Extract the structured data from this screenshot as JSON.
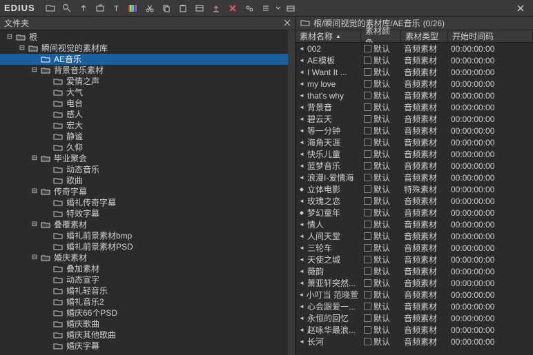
{
  "brand": "EDIUS",
  "left_panel_title": "文件夹",
  "right_panel": {
    "path": "根/瞬间视觉的素材库/AE音乐",
    "count": "(0/26)"
  },
  "columns": {
    "name": "素材名称",
    "color": "素材颜色",
    "type": "素材类型",
    "time": "开始时间码"
  },
  "tree": [
    {
      "label": "根",
      "depth": 0,
      "expand": "minus"
    },
    {
      "label": "瞬间视觉的素材库",
      "depth": 1,
      "expand": "minus"
    },
    {
      "label": "AE音乐",
      "depth": 2,
      "expand": "none",
      "selected": true
    },
    {
      "label": "背景音乐素材",
      "depth": 2,
      "expand": "minus"
    },
    {
      "label": "爱情之声",
      "depth": 3,
      "expand": "none"
    },
    {
      "label": "大气",
      "depth": 3,
      "expand": "none"
    },
    {
      "label": "电台",
      "depth": 3,
      "expand": "none"
    },
    {
      "label": "感人",
      "depth": 3,
      "expand": "none"
    },
    {
      "label": "宏大",
      "depth": 3,
      "expand": "none"
    },
    {
      "label": "静谧",
      "depth": 3,
      "expand": "none"
    },
    {
      "label": "久仰",
      "depth": 3,
      "expand": "none"
    },
    {
      "label": "毕业聚会",
      "depth": 2,
      "expand": "minus"
    },
    {
      "label": "动态音乐",
      "depth": 3,
      "expand": "none"
    },
    {
      "label": "歌曲",
      "depth": 3,
      "expand": "none"
    },
    {
      "label": "传奇字幕",
      "depth": 2,
      "expand": "minus"
    },
    {
      "label": "婚礼传奇字幕",
      "depth": 3,
      "expand": "none"
    },
    {
      "label": "特效字幕",
      "depth": 3,
      "expand": "none"
    },
    {
      "label": "叠覆素材",
      "depth": 2,
      "expand": "minus"
    },
    {
      "label": "婚礼前景素材bmp",
      "depth": 3,
      "expand": "none"
    },
    {
      "label": "婚礼前景素材PSD",
      "depth": 3,
      "expand": "none"
    },
    {
      "label": "婚庆素材",
      "depth": 2,
      "expand": "minus"
    },
    {
      "label": "叠加素材",
      "depth": 3,
      "expand": "none"
    },
    {
      "label": "动态宣字",
      "depth": 3,
      "expand": "none"
    },
    {
      "label": "婚礼轻音乐",
      "depth": 3,
      "expand": "none"
    },
    {
      "label": "婚礼音乐2",
      "depth": 3,
      "expand": "none"
    },
    {
      "label": "婚庆66个PSD",
      "depth": 3,
      "expand": "none"
    },
    {
      "label": "婚庆歌曲",
      "depth": 3,
      "expand": "none"
    },
    {
      "label": "婚庆其他歌曲",
      "depth": 3,
      "expand": "none"
    },
    {
      "label": "婚庆字幕",
      "depth": 3,
      "expand": "none"
    }
  ],
  "assets": [
    {
      "name": "002",
      "color": "默认",
      "type": "音频素材",
      "time": "00:00:00:00"
    },
    {
      "name": "AE模板",
      "color": "默认",
      "type": "音频素材",
      "time": "00:00:00:00"
    },
    {
      "name": "I Want It ...",
      "color": "默认",
      "type": "音频素材",
      "time": "00:00:00:00"
    },
    {
      "name": "my love",
      "color": "默认",
      "type": "音频素材",
      "time": "00:00:00:00"
    },
    {
      "name": "that's why",
      "color": "默认",
      "type": "音频素材",
      "time": "00:00:00:00"
    },
    {
      "name": "背景音",
      "color": "默认",
      "type": "音频素材",
      "time": "00:00:00:00"
    },
    {
      "name": "碧云天",
      "color": "默认",
      "type": "音频素材",
      "time": "00:00:00:00"
    },
    {
      "name": "等一分钟",
      "color": "默认",
      "type": "音频素材",
      "time": "00:00:00:00"
    },
    {
      "name": "海角天涯",
      "color": "默认",
      "type": "音频素材",
      "time": "00:00:00:00"
    },
    {
      "name": "快乐儿童",
      "color": "默认",
      "type": "音频素材",
      "time": "00:00:00:00"
    },
    {
      "name": "蓝梦音乐",
      "color": "默认",
      "type": "音频素材",
      "time": "00:00:00:00"
    },
    {
      "name": "浪漫I-爱情海",
      "color": "默认",
      "type": "音频素材",
      "time": "00:00:00:00"
    },
    {
      "name": "立体电影",
      "color": "默认",
      "type": "特殊素材",
      "time": "00:00:00:00",
      "special": true
    },
    {
      "name": "玫瑰之恋",
      "color": "默认",
      "type": "音频素材",
      "time": "00:00:00:00"
    },
    {
      "name": "梦幻童年",
      "color": "默认",
      "type": "音频素材",
      "time": "00:00:00:00",
      "special": true
    },
    {
      "name": "情人",
      "color": "默认",
      "type": "音频素材",
      "time": "00:00:00:00"
    },
    {
      "name": "人间天堂",
      "color": "默认",
      "type": "音频素材",
      "time": "00:00:00:00"
    },
    {
      "name": "三轮车",
      "color": "默认",
      "type": "音频素材",
      "time": "00:00:00:00"
    },
    {
      "name": "天使之城",
      "color": "默认",
      "type": "音频素材",
      "time": "00:00:00:00"
    },
    {
      "name": "薇韵",
      "color": "默认",
      "type": "音频素材",
      "time": "00:00:00:00"
    },
    {
      "name": "萧亚轩突然...",
      "color": "默认",
      "type": "音频素材",
      "time": "00:00:00:00"
    },
    {
      "name": "小叮当 范晓萱",
      "color": "默认",
      "type": "音频素材",
      "time": "00:00:00:00"
    },
    {
      "name": "心会跟爱一...",
      "color": "默认",
      "type": "音频素材",
      "time": "00:00:00:00"
    },
    {
      "name": "永恒的回忆",
      "color": "默认",
      "type": "音频素材",
      "time": "00:00:00:00"
    },
    {
      "name": "赵咏华最浪...",
      "color": "默认",
      "type": "音频素材",
      "time": "00:00:00:00"
    },
    {
      "name": "长河",
      "color": "默认",
      "type": "音频素材",
      "time": "00:00:00:00"
    }
  ]
}
